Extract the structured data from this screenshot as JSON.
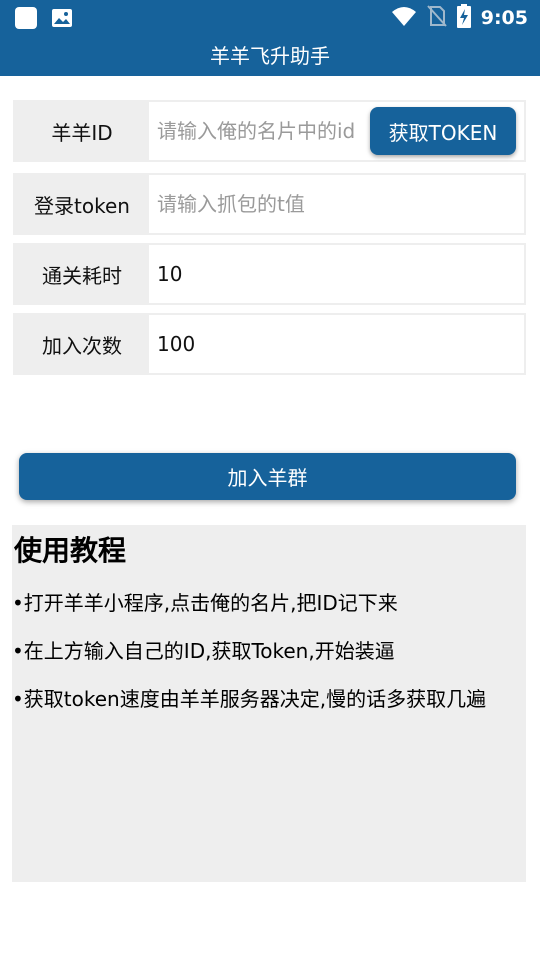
{
  "status_bar": {
    "time": "9:05",
    "icons": [
      "app-icon",
      "image-icon",
      "wifi-icon",
      "no-sim-icon",
      "battery-charging-icon"
    ]
  },
  "app_bar": {
    "title": "羊羊飞升助手"
  },
  "form": {
    "yangyang_id": {
      "label": "羊羊ID",
      "value": "",
      "placeholder": "请输入俺的名片中的id",
      "button_label": "获取TOKEN"
    },
    "login_token": {
      "label": "登录token",
      "value": "",
      "placeholder": "请输入抓包的t值"
    },
    "clear_time": {
      "label": "通关耗时",
      "value": "10"
    },
    "join_count": {
      "label": "加入次数",
      "value": "100"
    }
  },
  "join_button": {
    "label": "加入羊群"
  },
  "tutorial": {
    "title": "使用教程",
    "items": [
      "•打开羊羊小程序,点击俺的名片,把ID记下来",
      "•在上方输入自己的ID,获取Token,开始装逼",
      "•获取token速度由羊羊服务器决定,慢的话多获取几遍"
    ]
  },
  "colors": {
    "primary": "#16629b",
    "label_bg": "#eeeeee",
    "placeholder": "#9a9a9a"
  }
}
